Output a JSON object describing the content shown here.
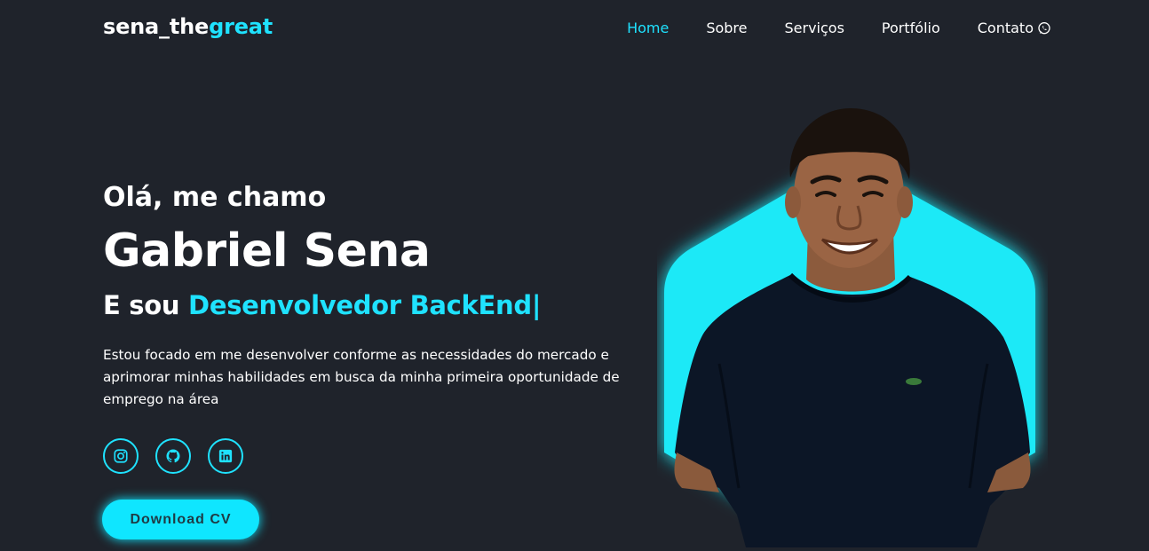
{
  "logo": {
    "main": "sena_the",
    "accent": "great"
  },
  "nav": {
    "home": "Home",
    "sobre": "Sobre",
    "servicos": "Serviços",
    "portfolio": "Portfólio",
    "contato": "Contato"
  },
  "hero": {
    "greeting": "Olá, me chamo",
    "name": "Gabriel Sena",
    "role_prefix": "E sou ",
    "role_accent": "Desenvolvedor BackEnd|",
    "description": "Estou focado em me desenvolver conforme as necessidades do mercado e aprimorar minhas habilidades em busca da minha primeira oportunidade de emprego na área"
  },
  "socials": [
    {
      "icon": "instagram-icon"
    },
    {
      "icon": "github-icon"
    },
    {
      "icon": "linkedin-icon"
    }
  ],
  "cv_button": "Download CV",
  "colors": {
    "background": "#1f232b",
    "accent": "#1fe2ff",
    "text": "#ffffff"
  }
}
